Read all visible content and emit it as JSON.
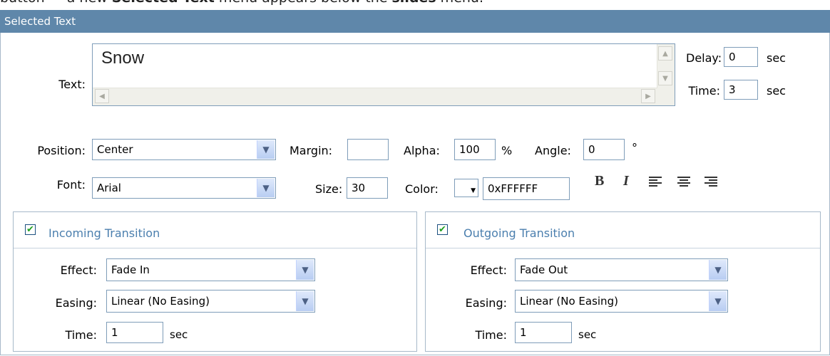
{
  "caption": {
    "prefix": "button — a new ",
    "bold1": "Selected Text",
    "mid": " menu appears below the ",
    "bold2": "slides",
    "suffix": " menu."
  },
  "header": {
    "title": "Selected Text"
  },
  "text_field": {
    "label": "Text:",
    "value": "Snow"
  },
  "delay": {
    "label": "Delay:",
    "value": "0",
    "unit": "sec"
  },
  "time": {
    "label": "Time:",
    "value": "3",
    "unit": "sec"
  },
  "position": {
    "label": "Position:",
    "value": "Center"
  },
  "margin": {
    "label": "Margin:",
    "value": ""
  },
  "alpha": {
    "label": "Alpha:",
    "value": "100",
    "unit": "%"
  },
  "angle": {
    "label": "Angle:",
    "value": "0",
    "unit": "°"
  },
  "font": {
    "label": "Font:",
    "value": "Arial"
  },
  "size": {
    "label": "Size:",
    "value": "30"
  },
  "color": {
    "label": "Color:",
    "value": "0xFFFFFF",
    "swatch": "#FFFFFF"
  },
  "format": {
    "bold": "B",
    "italic": "I"
  },
  "incoming": {
    "title": "Incoming Transition",
    "checked": true,
    "effect_label": "Effect:",
    "effect": "Fade In",
    "easing_label": "Easing:",
    "easing": "Linear (No Easing)",
    "time_label": "Time:",
    "time": "1",
    "unit": "sec"
  },
  "outgoing": {
    "title": "Outgoing Transition",
    "checked": true,
    "effect_label": "Effect:",
    "effect": "Fade Out",
    "easing_label": "Easing:",
    "easing": "Linear (No Easing)",
    "time_label": "Time:",
    "time": "1",
    "unit": "sec"
  },
  "colors": {
    "header_bg": "#5F87AA",
    "transition_title": "#4B7FAE",
    "border": "#7F9DB9"
  }
}
